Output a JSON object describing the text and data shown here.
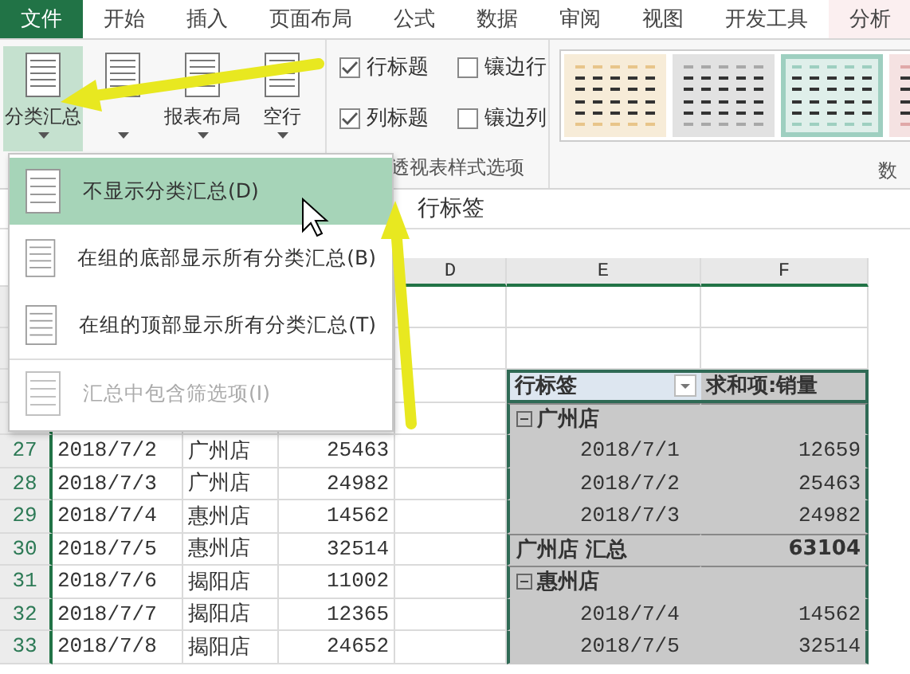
{
  "tabs": [
    {
      "label": "文件",
      "kind": "file",
      "selected": false
    },
    {
      "label": "开始",
      "kind": "tab",
      "selected": false
    },
    {
      "label": "插入",
      "kind": "tab",
      "selected": false
    },
    {
      "label": "页面布局",
      "kind": "tab",
      "selected": false
    },
    {
      "label": "公式",
      "kind": "tab",
      "selected": false
    },
    {
      "label": "数据",
      "kind": "tab",
      "selected": false
    },
    {
      "label": "审阅",
      "kind": "tab",
      "selected": false
    },
    {
      "label": "视图",
      "kind": "tab",
      "selected": false
    },
    {
      "label": "开发工具",
      "kind": "tab",
      "selected": false
    },
    {
      "label": "分析",
      "kind": "tab",
      "selected": true
    }
  ],
  "layout_buttons": [
    {
      "label": "分类汇总",
      "selected": true
    },
    {
      "selected": false
    },
    {
      "label": "报表布局",
      "selected": false
    },
    {
      "label": "空行",
      "selected": false
    }
  ],
  "style_options": {
    "checkboxes": [
      {
        "label": "行标题",
        "checked": true
      },
      {
        "label": "镶边行",
        "checked": false
      },
      {
        "label": "列标题",
        "checked": true
      },
      {
        "label": "镶边列",
        "checked": false
      }
    ],
    "group_label": "透视表样式选项"
  },
  "styles": {
    "thumbnails": [
      {
        "color": "#e8c58a",
        "selected": false
      },
      {
        "color": "#a8a8a8",
        "selected": false
      },
      {
        "color": "#9ecfc0",
        "selected": true
      },
      {
        "color": "#e0a8a8",
        "selected": false
      }
    ],
    "group_label": "数"
  },
  "formula_bar": {
    "value": "行标签"
  },
  "dropdown_menu": {
    "items": [
      {
        "label": "不显示分类汇总(D)",
        "selected": true,
        "disabled": false
      },
      {
        "label": "在组的底部显示所有分类汇总(B)",
        "selected": false,
        "disabled": false
      },
      {
        "label": "在组的顶部显示所有分类汇总(T)",
        "selected": false,
        "disabled": false
      },
      {
        "label": "汇总中包含筛选项(I)",
        "selected": false,
        "disabled": true
      }
    ]
  },
  "sheet": {
    "columns": [
      "D",
      "E",
      "F"
    ],
    "rows": [
      {
        "number": "27",
        "date": "2018/7/2",
        "store": "广州店",
        "sales": "25463"
      },
      {
        "number": "28",
        "date": "2018/7/3",
        "store": "广州店",
        "sales": "24982"
      },
      {
        "number": "29",
        "date": "2018/7/4",
        "store": "惠州店",
        "sales": "14562"
      },
      {
        "number": "30",
        "date": "2018/7/5",
        "store": "惠州店",
        "sales": "32514"
      },
      {
        "number": "31",
        "date": "2018/7/6",
        "store": "揭阳店",
        "sales": "11002"
      },
      {
        "number": "32",
        "date": "2018/7/7",
        "store": "揭阳店",
        "sales": "12365"
      },
      {
        "number": "33",
        "date": "2018/7/8",
        "store": "揭阳店",
        "sales": "24652"
      }
    ]
  },
  "pivot": {
    "header": {
      "row_label": "行标签",
      "value_label": "求和项:销量"
    },
    "rows": [
      {
        "kind": "group",
        "label": "广州店",
        "expanded": true
      },
      {
        "kind": "item",
        "label": "2018/7/1",
        "value": "12659"
      },
      {
        "kind": "item",
        "label": "2018/7/2",
        "value": "25463"
      },
      {
        "kind": "item",
        "label": "2018/7/3",
        "value": "24982"
      },
      {
        "kind": "subtotal",
        "label": "广州店 汇总",
        "value": "63104"
      },
      {
        "kind": "group",
        "label": "惠州店",
        "expanded": true
      },
      {
        "kind": "item",
        "label": "2018/7/4",
        "value": "14562"
      },
      {
        "kind": "item",
        "label": "2018/7/5",
        "value": "32514"
      }
    ]
  }
}
